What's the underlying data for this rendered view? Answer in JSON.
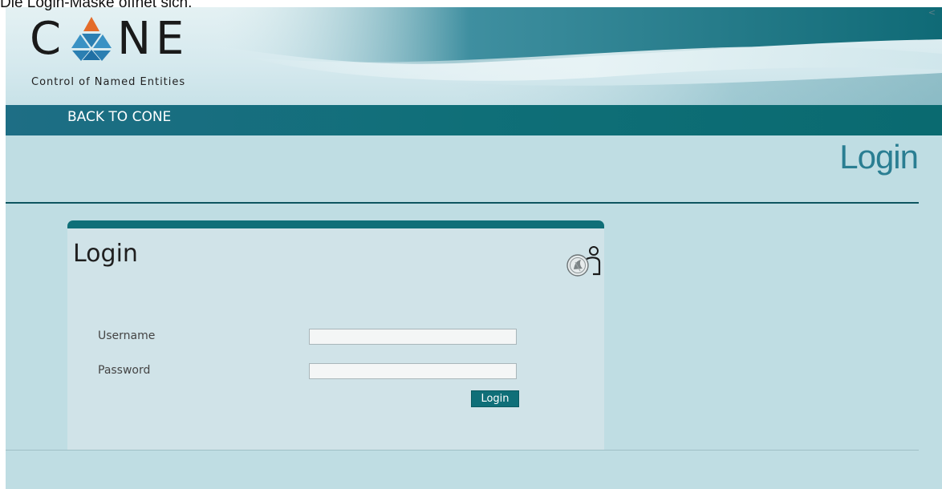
{
  "caption": "Die Login-Maske öffnet sich.",
  "banner": {
    "brand_letters": [
      "C",
      "NE"
    ],
    "subtitle": "Control of Named Entities",
    "corner_mark": "<"
  },
  "nav": {
    "back_label": "BACK TO CONE"
  },
  "page": {
    "heading": "Login"
  },
  "login_panel": {
    "title": "Login",
    "username_label": "Username",
    "password_label": "Password",
    "username_value": "",
    "password_value": "",
    "submit_label": "Login",
    "logo_icon": "institution-seal-person-icon"
  },
  "colors": {
    "brand_teal": "#0f6f78",
    "page_background": "#bfdde3",
    "panel_background": "#d0e3e8",
    "heading_color": "#2a7e92",
    "logo_orange": "#e46c2a",
    "logo_blue": "#2b7fb2"
  }
}
